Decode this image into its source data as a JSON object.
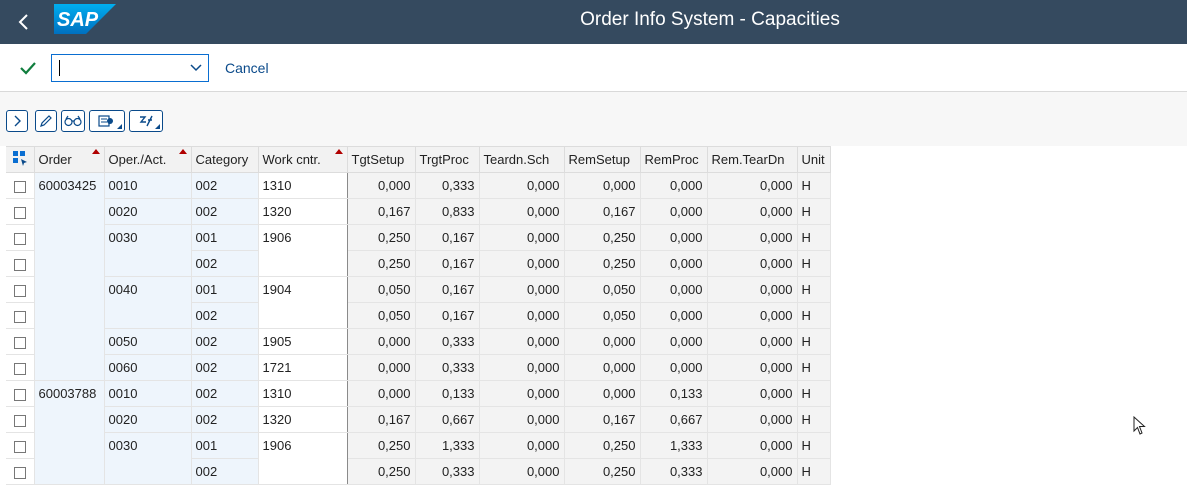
{
  "shell": {
    "title": "Order Info System - Capacities",
    "logo": "SAP"
  },
  "toolbar": {
    "combo_value": "",
    "cancel_label": "Cancel"
  },
  "columns": [
    "Order",
    "Oper./Act.",
    "Category",
    "Work cntr.",
    "TgtSetup",
    "TrgtProc",
    "Teardn.Sch",
    "RemSetup",
    "RemProc",
    "Rem.TearDn",
    "Unit"
  ],
  "rows": [
    [
      "60003425",
      "0010",
      "002",
      "1310",
      "0,000",
      "0,333",
      "0,000",
      "0,000",
      "0,000",
      "0,000",
      "H"
    ],
    [
      "",
      "0020",
      "002",
      "1320",
      "0,167",
      "0,833",
      "0,000",
      "0,167",
      "0,000",
      "0,000",
      "H"
    ],
    [
      "",
      "0030",
      "001",
      "1906",
      "0,250",
      "0,167",
      "0,000",
      "0,250",
      "0,000",
      "0,000",
      "H"
    ],
    [
      "",
      "",
      "002",
      "",
      "0,250",
      "0,167",
      "0,000",
      "0,250",
      "0,000",
      "0,000",
      "H"
    ],
    [
      "",
      "0040",
      "001",
      "1904",
      "0,050",
      "0,167",
      "0,000",
      "0,050",
      "0,000",
      "0,000",
      "H"
    ],
    [
      "",
      "",
      "002",
      "",
      "0,050",
      "0,167",
      "0,000",
      "0,050",
      "0,000",
      "0,000",
      "H"
    ],
    [
      "",
      "0050",
      "002",
      "1905",
      "0,000",
      "0,333",
      "0,000",
      "0,000",
      "0,000",
      "0,000",
      "H"
    ],
    [
      "",
      "0060",
      "002",
      "1721",
      "0,000",
      "0,333",
      "0,000",
      "0,000",
      "0,000",
      "0,000",
      "H"
    ],
    [
      "60003788",
      "0010",
      "002",
      "1310",
      "0,000",
      "0,133",
      "0,000",
      "0,000",
      "0,133",
      "0,000",
      "H"
    ],
    [
      "",
      "0020",
      "002",
      "1320",
      "0,167",
      "0,667",
      "0,000",
      "0,167",
      "0,667",
      "0,000",
      "H"
    ],
    [
      "",
      "0030",
      "001",
      "1906",
      "0,250",
      "1,333",
      "0,000",
      "0,250",
      "1,333",
      "0,000",
      "H"
    ],
    [
      "",
      "",
      "002",
      "",
      "0,250",
      "0,333",
      "0,000",
      "0,250",
      "0,333",
      "0,000",
      "H"
    ]
  ],
  "icons": {
    "back": "chevron-left-icon",
    "confirm": "checkmark-icon",
    "expand": "chevron-right-icon",
    "edit": "pencil-icon",
    "display": "glasses-icon",
    "settings": "settings-menu-icon",
    "sum": "sum-menu-icon",
    "layout": "layout-icon"
  },
  "colors": {
    "shell": "#354a5f",
    "accent": "#0a6ed1",
    "sort_marker": "#b00000"
  }
}
